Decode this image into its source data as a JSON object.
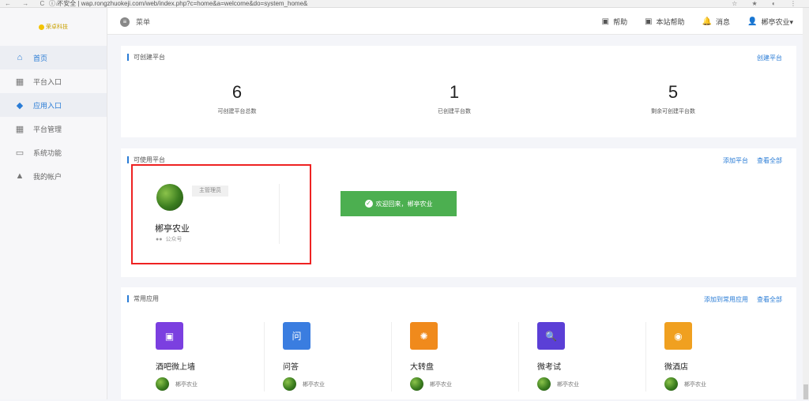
{
  "browser": {
    "nav": "← → C ⌂",
    "url": "ⓘ 不安全 | wap.rongzhuokeji.com/web/index.php?c=home&a=welcome&do=system_home&",
    "right_icons": "☆ ★ ◐ ⋮"
  },
  "sidebar": {
    "logo_text": "荣卓科技",
    "items": [
      {
        "label": "首页",
        "icon": "home-icon",
        "glyph": "⌂"
      },
      {
        "label": "平台入口",
        "icon": "grid-icon",
        "glyph": "▦"
      },
      {
        "label": "应用入口",
        "icon": "cube-icon",
        "glyph": "◆"
      },
      {
        "label": "平台管理",
        "icon": "apps-icon",
        "glyph": "▦"
      },
      {
        "label": "系统功能",
        "icon": "monitor-icon",
        "glyph": "▭"
      },
      {
        "label": "我的帐户",
        "icon": "bell-icon",
        "glyph": "▲"
      }
    ]
  },
  "topbar": {
    "menu_label": "菜单",
    "links": [
      {
        "label": "帮助",
        "glyph": "▣"
      },
      {
        "label": "本站帮助",
        "glyph": "▣"
      },
      {
        "label": "消息",
        "glyph": "🔔"
      },
      {
        "label": "郴亭农业▾",
        "glyph": "👤"
      }
    ]
  },
  "creatable": {
    "title": "可创建平台",
    "link": "创建平台",
    "stats": [
      {
        "value": "6",
        "label": "可创建平台总数"
      },
      {
        "value": "1",
        "label": "已创建平台数"
      },
      {
        "value": "5",
        "label": "剩余可创建平台数"
      }
    ]
  },
  "usable": {
    "title": "可使用平台",
    "links": [
      "添加平台",
      "查看全部"
    ],
    "platform": {
      "role": "主管理员",
      "name": "郴亭农业",
      "type": "公众号"
    },
    "welcome": "欢迎回来，郴亭农业"
  },
  "common": {
    "title": "常用应用",
    "links": [
      "添加到常用应用",
      "查看全部"
    ],
    "apps": [
      {
        "name": "酒吧微上墙",
        "owner": "郴亭农业",
        "color": "#7b3fe0",
        "glyph": "▣"
      },
      {
        "name": "问答",
        "owner": "郴亭农业",
        "color": "#3a7de0",
        "glyph": "问"
      },
      {
        "name": "大转盘",
        "owner": "郴亭农业",
        "color": "#f08a1c",
        "glyph": "✺"
      },
      {
        "name": "微考试",
        "owner": "郴亭农业",
        "color": "#5b3fd6",
        "glyph": "🔍"
      },
      {
        "name": "微酒店",
        "owner": "郴亭农业",
        "color": "#f0a020",
        "glyph": "◉"
      }
    ]
  }
}
